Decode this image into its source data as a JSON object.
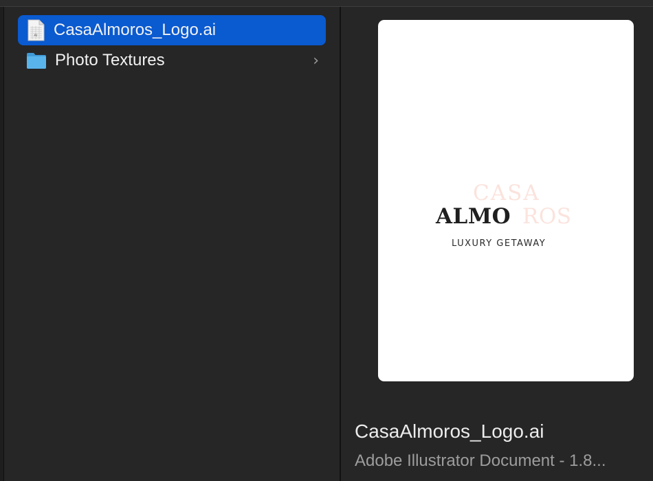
{
  "file_list": {
    "items": [
      {
        "name": "CasaAlmoros_Logo.ai",
        "icon": "illustrator-document-icon",
        "selected": true
      },
      {
        "name": "Photo Textures",
        "icon": "folder-icon",
        "has_children": true,
        "chevron": "›"
      }
    ]
  },
  "preview": {
    "logo": {
      "word_casa": "CASA",
      "word_almo": "ALMO",
      "word_ros": "ROS",
      "tagline": "LUXURY GETAWAY"
    },
    "file_name": "CasaAlmoros_Logo.ai",
    "file_kind": "Adobe Illustrator Document - 1.8..."
  },
  "colors": {
    "selection": "#0a5ad0",
    "folder": "#5ab4ec",
    "background": "#262626"
  }
}
